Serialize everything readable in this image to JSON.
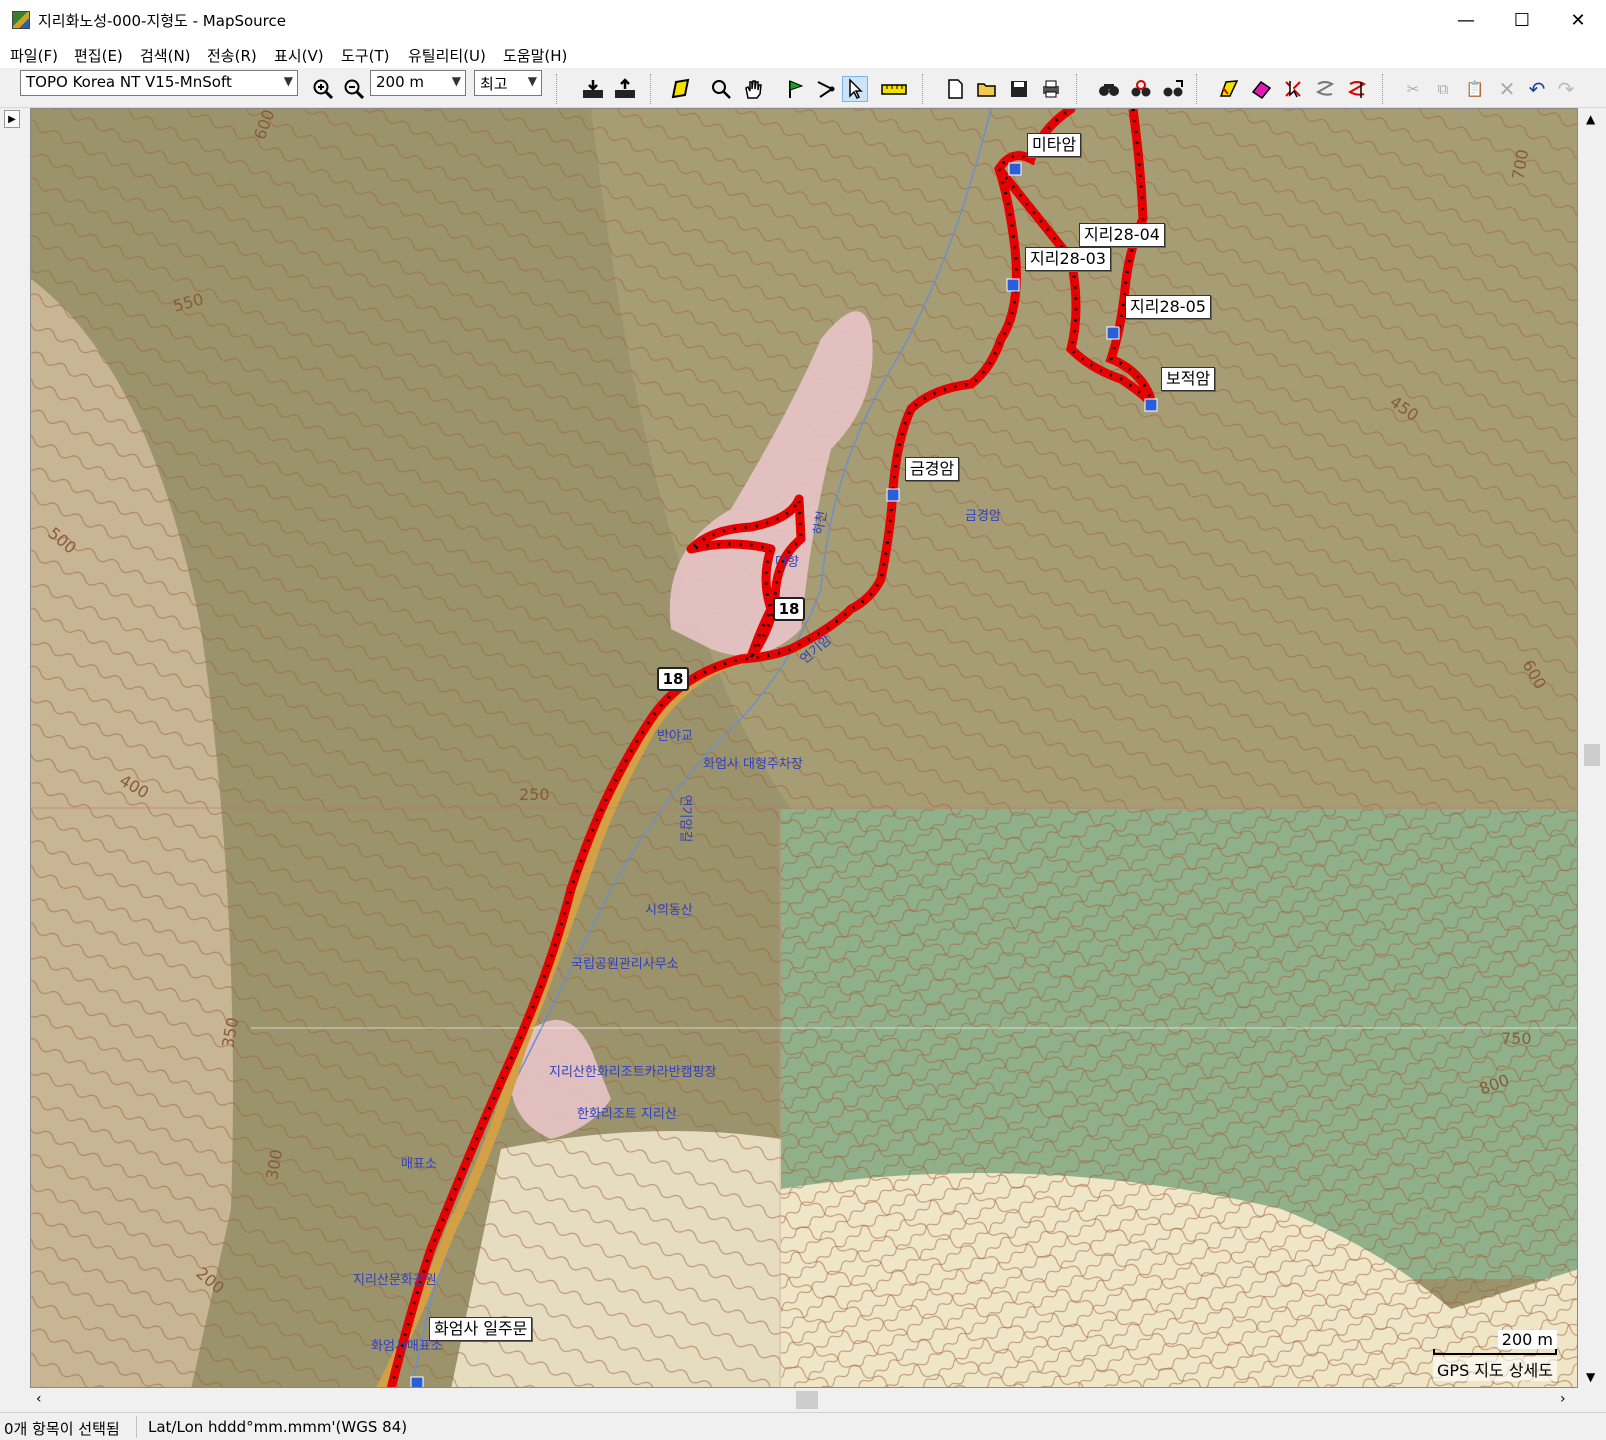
{
  "window": {
    "title": "지리화노성-000-지형도 - MapSource",
    "minimize": "—",
    "maximize": "☐",
    "close": "✕"
  },
  "menu": [
    "파일(F)",
    "편집(E)",
    "검색(N)",
    "전송(R)",
    "표시(V)",
    "도구(T)",
    "유틸리티(U)",
    "도움말(H)"
  ],
  "toolbar": {
    "map_product": "TOPO Korea NT V15-MnSoft",
    "zoom_scale": "200 m",
    "detail_level": "최고"
  },
  "map": {
    "waypoints": [
      "미타암",
      "지리28-04",
      "지리28-03",
      "지리28-05",
      "보적암",
      "금경암",
      "화엄사 일주문"
    ],
    "route_badges": [
      "18",
      "18"
    ],
    "pois": [
      "금경암",
      "다향",
      "연기암",
      "반야교",
      "화엄사 대형주차장",
      "연기암길",
      "시의동산",
      "국립공원관리사무소",
      "지리산한화리조트카라반캠핑장",
      "한화리조트 지리산",
      "매표소",
      "지리산문화공원",
      "하천",
      "화엄사매표소"
    ],
    "contours": [
      "600",
      "550",
      "500",
      "400",
      "250",
      "350",
      "300",
      "200",
      "700",
      "450",
      "750",
      "800",
      "600"
    ],
    "scale_label": "200 m",
    "map_detail_caption": "GPS 지도 상세도"
  },
  "status": {
    "selection": "0개 항목이 선택됨",
    "coord_format": "Lat/Lon hddd°mm.mmm'(WGS 84)"
  },
  "colors": {
    "track": "#e60000",
    "terrain_brown": "#9a936b",
    "terrain_green": "#8fb08a",
    "terrain_sand": "#e6dcc0",
    "settlement_pink": "#e8c4c8"
  },
  "icons": [
    "zoom-in-icon",
    "zoom-out-icon",
    "receive-from-device-icon",
    "send-to-device-icon",
    "map-tool-icon",
    "zoom-tool-icon",
    "hand-tool-icon",
    "waypoint-tool-icon",
    "route-tool-icon",
    "select-tool-icon",
    "distance-tool-icon",
    "new-file-icon",
    "open-file-icon",
    "save-icon",
    "print-icon",
    "find-icon",
    "find-places-icon",
    "find-recent-icon",
    "track-tool-icon",
    "erase-tool-icon",
    "track-select-icon",
    "route-draw-icon",
    "waypoint-route-icon",
    "cut-icon",
    "copy-icon",
    "paste-icon",
    "delete-icon",
    "undo-icon",
    "redo-icon"
  ]
}
